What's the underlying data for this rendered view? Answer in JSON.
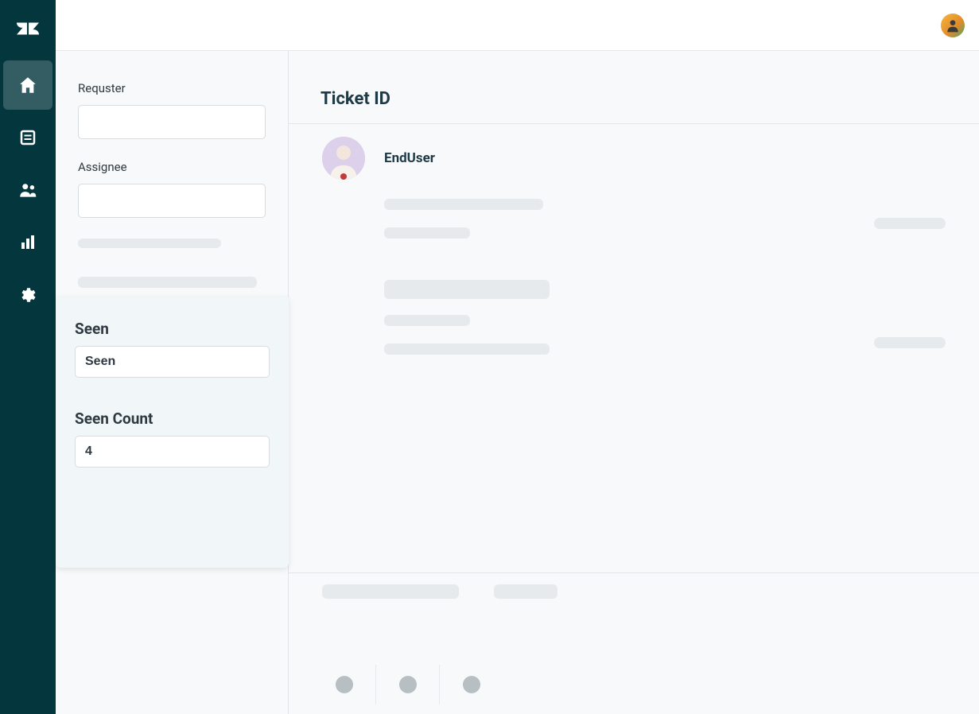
{
  "sidebar": {
    "requester_label": "Requster",
    "requester_value": "",
    "assignee_label": "Assignee",
    "assignee_value": ""
  },
  "app_card": {
    "seen": {
      "title": "Seen",
      "value": "Seen"
    },
    "seen_count": {
      "title": "Seen Count",
      "value": "4"
    }
  },
  "ticket": {
    "title": "Ticket  ID",
    "requester_name": "EndUser"
  },
  "nav": {
    "items": [
      "home",
      "views",
      "customers",
      "reporting",
      "admin"
    ]
  }
}
